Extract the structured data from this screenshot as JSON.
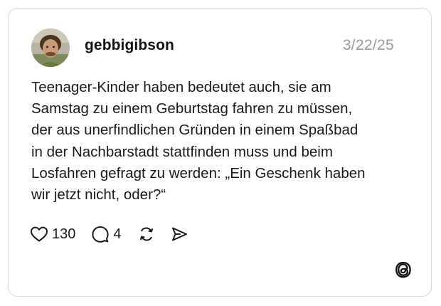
{
  "post": {
    "username": "gebbigibson",
    "date": "3/22/25",
    "text_lines": [
      "Teenager-Kinder haben bedeutet auch, sie am",
      "Samstag zu einem Geburtstag fahren zu müssen,",
      "der aus unerfindlichen Gründen in einem Spaßbad",
      "in der Nachbarstadt stattfinden muss und beim",
      "Losfahren gefragt zu werden: „Ein Geschenk haben",
      "wir jetzt nicht, oder?“"
    ],
    "likes": "130",
    "replies": "4"
  },
  "icons": {
    "like": "heart-icon",
    "reply": "speech-bubble-icon",
    "repost": "repost-icon",
    "share": "send-icon",
    "brand": "threads-logo-icon"
  },
  "colors": {
    "text": "#1a1a1a",
    "muted": "#9a9a9a",
    "border": "#d9d9d9"
  }
}
